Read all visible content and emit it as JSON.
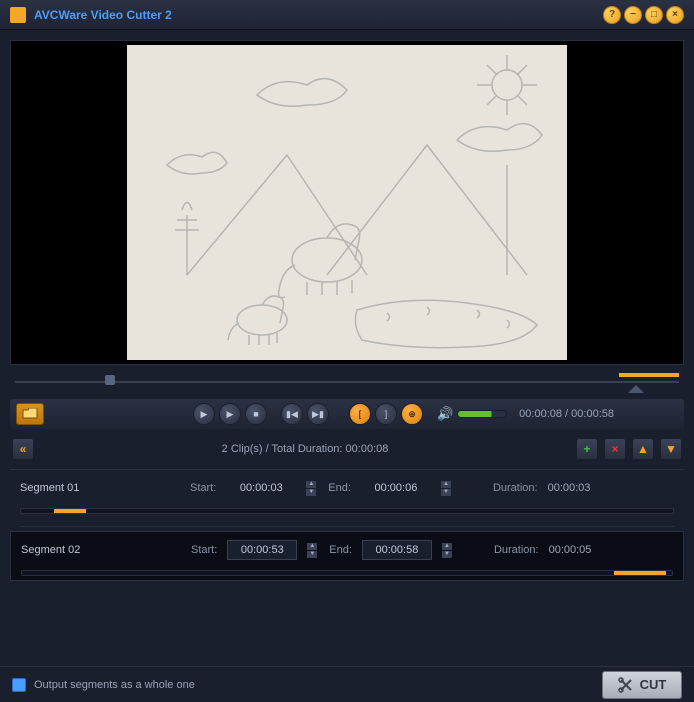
{
  "title": "AVCWare Video Cutter 2",
  "player": {
    "current_time": "00:00:08",
    "total_time": "00:00:58"
  },
  "clips": {
    "summary": "2 Clip(s) /  Total Duration: 00:00:08"
  },
  "segments": [
    {
      "name": "Segment 01",
      "start_label": "Start:",
      "start": "00:00:03",
      "end_label": "End:",
      "end": "00:00:06",
      "duration_label": "Duration:",
      "duration": "00:00:03",
      "range_left_pct": 5,
      "range_width_pct": 5
    },
    {
      "name": "Segment 02",
      "start_label": "Start:",
      "start": "00:00:53",
      "end_label": "End:",
      "end": "00:00:58",
      "duration_label": "Duration:",
      "duration": "00:00:05",
      "range_left_pct": 91,
      "range_width_pct": 8
    }
  ],
  "footer": {
    "checkbox_label": "Output segments as a whole one",
    "cut_label": "CUT"
  },
  "icons": {
    "help": "?",
    "minimize": "−",
    "maximize": "□",
    "close": "×",
    "play": "▶",
    "stop": "■",
    "prev": "▮◀",
    "next": "▶▮",
    "volume": "🔊",
    "up": "▲",
    "down": "▼",
    "add": "+",
    "remove": "×",
    "collapse": "«"
  }
}
